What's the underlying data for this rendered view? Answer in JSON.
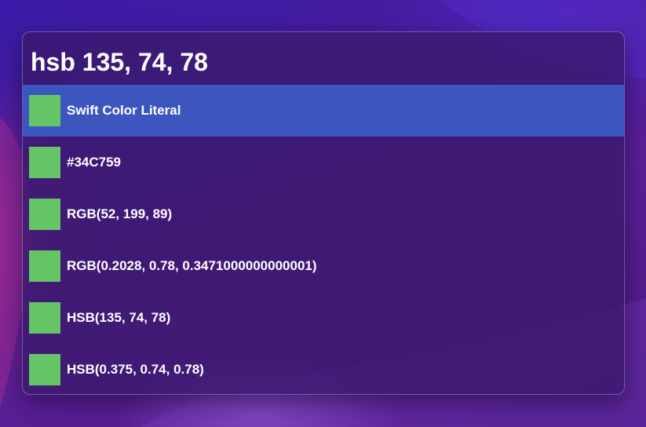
{
  "search": {
    "query": "hsb 135, 74, 78"
  },
  "colors": {
    "result_swatch": "#65C466",
    "selection": "#3C55BF"
  },
  "results": [
    {
      "label": "Swift Color Literal",
      "selected": true
    },
    {
      "label": "#34C759",
      "selected": false
    },
    {
      "label": "RGB(52, 199, 89)",
      "selected": false
    },
    {
      "label": "RGB(0.2028, 0.78, 0.3471000000000001)",
      "selected": false
    },
    {
      "label": "HSB(135, 74, 78)",
      "selected": false
    },
    {
      "label": "HSB(0.375, 0.74, 0.78)",
      "selected": false
    }
  ]
}
